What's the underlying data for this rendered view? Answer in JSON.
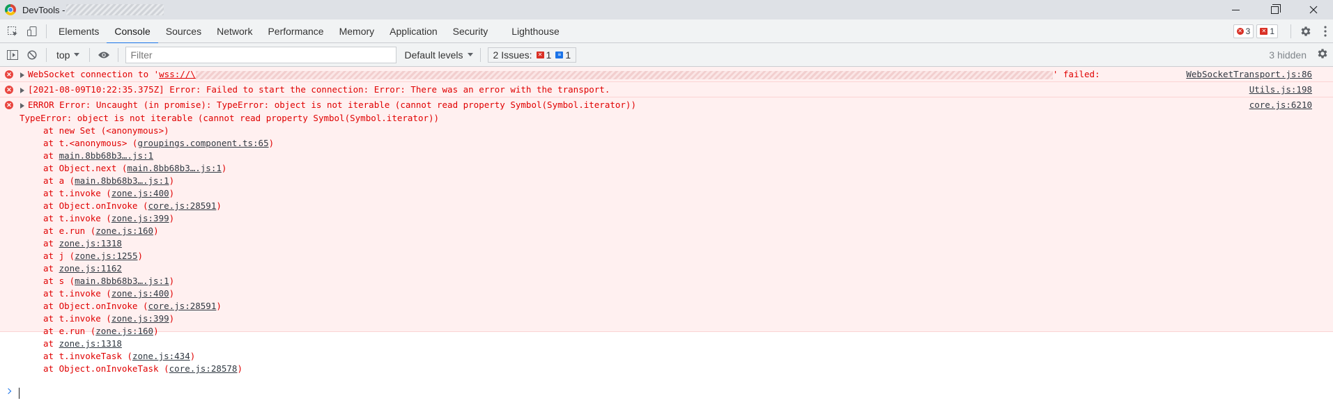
{
  "window": {
    "title": "DevTools - ",
    "icon": "chrome-icon"
  },
  "tabs": [
    {
      "label": "Elements"
    },
    {
      "label": "Console"
    },
    {
      "label": "Sources"
    },
    {
      "label": "Network"
    },
    {
      "label": "Performance"
    },
    {
      "label": "Memory"
    },
    {
      "label": "Application"
    },
    {
      "label": "Security"
    },
    {
      "label": "Lighthouse"
    }
  ],
  "active_tab": "Console",
  "badges": {
    "errors": "3",
    "issues": "1"
  },
  "toolbar": {
    "context": "top",
    "filter_placeholder": "Filter",
    "levels": "Default levels",
    "issues_label": "2 Issues:",
    "issues_errors": "1",
    "issues_info": "1",
    "hidden": "3 hidden"
  },
  "messages": [
    {
      "prefix": "WebSocket connection to '",
      "url": "wss://\\",
      "suffix": "' failed:",
      "source": "WebSocketTransport.js:86"
    },
    {
      "text": "[2021-08-09T10:22:35.375Z] Error: Failed to start the connection: Error: There was an error with the transport.",
      "source": "Utils.js:198"
    },
    {
      "text": "ERROR Error: Uncaught (in promise): TypeError: object is not iterable (cannot read property Symbol(Symbol.iterator))",
      "source": "core.js:6210",
      "error_line": "TypeError: object is not iterable (cannot read property Symbol(Symbol.iterator))",
      "stack": [
        {
          "pre": "at new Set (<anonymous>)",
          "link": "",
          "post": ""
        },
        {
          "pre": "at t.<anonymous> (",
          "link": "groupings.component.ts:65",
          "post": ")"
        },
        {
          "pre": "at ",
          "link": "main.8bb68b3….js:1",
          "post": ""
        },
        {
          "pre": "at Object.next (",
          "link": "main.8bb68b3….js:1",
          "post": ")"
        },
        {
          "pre": "at a (",
          "link": "main.8bb68b3….js:1",
          "post": ")"
        },
        {
          "pre": "at t.invoke (",
          "link": "zone.js:400",
          "post": ")"
        },
        {
          "pre": "at Object.onInvoke (",
          "link": "core.js:28591",
          "post": ")"
        },
        {
          "pre": "at t.invoke (",
          "link": "zone.js:399",
          "post": ")"
        },
        {
          "pre": "at e.run (",
          "link": "zone.js:160",
          "post": ")"
        },
        {
          "pre": "at ",
          "link": "zone.js:1318",
          "post": ""
        },
        {
          "pre": "at j (",
          "link": "zone.js:1255",
          "post": ")"
        },
        {
          "pre": "at ",
          "link": "zone.js:1162",
          "post": ""
        },
        {
          "pre": "at s (",
          "link": "main.8bb68b3….js:1",
          "post": ")"
        },
        {
          "pre": "at t.invoke (",
          "link": "zone.js:400",
          "post": ")"
        },
        {
          "pre": "at Object.onInvoke (",
          "link": "core.js:28591",
          "post": ")"
        },
        {
          "pre": "at t.invoke (",
          "link": "zone.js:399",
          "post": ")"
        },
        {
          "pre": "at e.run (",
          "link": "zone.js:160",
          "post": ")"
        },
        {
          "pre": "at ",
          "link": "zone.js:1318",
          "post": ""
        },
        {
          "pre": "at t.invokeTask (",
          "link": "zone.js:434",
          "post": ")"
        },
        {
          "pre": "at Object.onInvokeTask (",
          "link": "core.js:28578",
          "post": ")"
        }
      ]
    }
  ]
}
